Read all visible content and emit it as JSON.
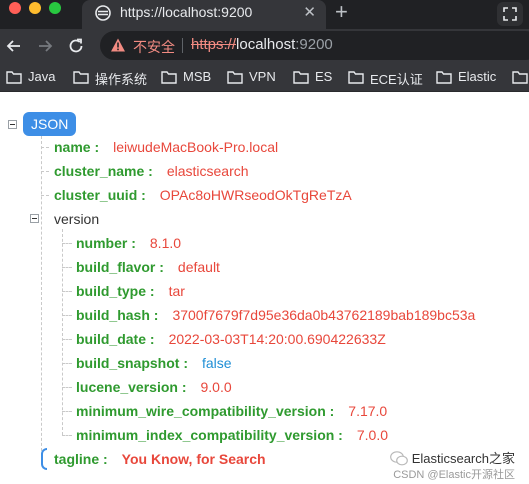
{
  "browser": {
    "tab": {
      "title": "https://localhost:9200",
      "close_glyph": "✕",
      "icon": "elasticsearch-favicon-icon"
    },
    "new_tab_glyph": "+",
    "address_bar": {
      "security_label": "不安全",
      "url_scheme": "https://",
      "url_host": "localhost",
      "url_port": ":9200",
      "security_color": "#f28b82"
    },
    "bookmarks": [
      "Java",
      "操作系统",
      "MSB",
      "VPN",
      "ES",
      "ECE认证",
      "Elastic"
    ]
  },
  "json_viewer": {
    "root_label": "JSON",
    "accent_color": "#3d8ee6",
    "key_color": "#2f9a2f",
    "value_color": "#e8473b",
    "entries": [
      {
        "key": "name :",
        "value": "leiwudeMacBook-Pro.local"
      },
      {
        "key": "cluster_name :",
        "value": "elasticsearch"
      },
      {
        "key": "cluster_uuid :",
        "value": "OPAc8oHWRseodOkTgReTzA"
      }
    ],
    "version": {
      "key": "version",
      "fields": [
        {
          "key": "number :",
          "value": "8.1.0"
        },
        {
          "key": "build_flavor :",
          "value": "default"
        },
        {
          "key": "build_type :",
          "value": "tar"
        },
        {
          "key": "build_hash :",
          "value": "3700f7679f7d95e36da0b43762189bab189bc53a"
        },
        {
          "key": "build_date :",
          "value": "2022-03-03T14:20:00.690422633Z"
        },
        {
          "key": "build_snapshot :",
          "value": "false",
          "type": "boolean"
        },
        {
          "key": "lucene_version :",
          "value": "9.0.0"
        },
        {
          "key": "minimum_wire_compatibility_version :",
          "value": "7.17.0"
        },
        {
          "key": "minimum_index_compatibility_version :",
          "value": "7.0.0"
        }
      ]
    },
    "tagline": {
      "key": "tagline :",
      "value": "You Know, for Search"
    }
  },
  "watermark": {
    "main": "Elasticsearch之家",
    "sub": "CSDN @Elastic开源社区",
    "icon": "wechat-icon"
  }
}
